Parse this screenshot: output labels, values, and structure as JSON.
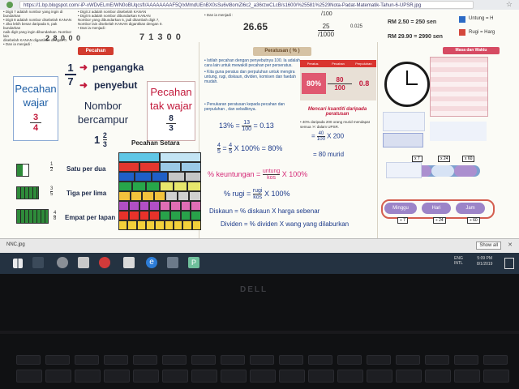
{
  "browser": {
    "url": "https://1.bp.blogspot.com/-iP-xWDvELmE/WN0oBUqcsfI/AAAAAAAAF5Q/xMmdUEnBX0sSu6vl8omZl6c2_a36rzwCLcB/s1600/%25581%2529Nota-Padat-Matematik-Tahun-6-UPSR.jpg"
  },
  "top": {
    "left_lines": [
      "• Digit 7 adalah nombor yang ingin di bundarkan",
      "• Digit 8 adalah nombor disebelah KANAN",
      "• Jika lebih besar daripada 5, pak bundarkan",
      "  naik digit yang ingin dibundarkan. Nombor lain",
      "  disebelah KANAN digantikan dengan 0.",
      "• Dan ia menjadi :"
    ],
    "left_value": "2 8 0 0 0",
    "mid_lines": [
      "• Digit 2 adalah nombor disebelah KANAN",
      "• Digit 5 adalah nombor dibundarkan KANAN",
      "Nombor yang dibundarkan 5, jadi ditambah digit 7,",
      "Nombor lain disebelah KANAN digantikan dengan 0.",
      "• Dan ia menjadi :"
    ],
    "mid_value": "7 1 3 0 0",
    "round_lines": [
      "• Dan ia menjadi :"
    ],
    "round_value": "26.65",
    "frac_top": "/100",
    "frac_mid_num": "25",
    "frac_mid_den": "/1000",
    "frac_dec": "0.025",
    "money1": "RM 2.50 = 250 sen",
    "money2": "RM 29.90 = 2990 sen",
    "legend1": "Untung = H",
    "legend2": "Rugi = Harg"
  },
  "pecahan": {
    "header": "Pecahan",
    "numerator": "1",
    "denominator": "7",
    "pengangka": "pengangka",
    "penyebut": "penyebut",
    "wajar_label": "Pecahan wajar",
    "wajar_num": "3",
    "wajar_den": "4",
    "campur_label": "Nombor bercampur",
    "campur_whole": "1",
    "campur_num": "2",
    "campur_den": "3",
    "takwajar_label": "Pecahan tak wajar",
    "takwajar_num": "8",
    "takwajar_den": "3",
    "setara_title": "Pecahan Setara",
    "rows": [
      {
        "num": "1",
        "den": "2",
        "label": "Satu per dua"
      },
      {
        "num": "3",
        "den": "5",
        "label": "Tiga per lima"
      },
      {
        "num": "4",
        "den": "8",
        "label": "Empat per lapan"
      }
    ]
  },
  "peratusan": {
    "header": "Peratusan ( % )",
    "bullets": [
      "• Istilah pecahan dengan penyebutnya 100. Ia adalah cara lain untuk mewakili pecahan per perseratus.",
      "• Kita guna peratus dan perpuluhan untuk mengira untung, rugi, diskaun, dividen, komisen dan faedah mudah."
    ],
    "table_head": [
      "Peratus",
      "Pecahan",
      "Perpuluhan"
    ],
    "table_vals": [
      "80%",
      "80",
      "100",
      "0.8"
    ],
    "note": "• Penukaran peratusan kepada pecahan dan perpuluhan , dan sebaliknya.",
    "eq1_lhs": "13% =",
    "eq1_num": "13",
    "eq1_den": "100",
    "eq1_rhs": "= 0.13",
    "eq2_num": "4",
    "eq2_den": "5",
    "eq2_rhs": "X 100% = 80%",
    "mencari_title": "Mencari kuantiti daripada peratusan",
    "mencari_text": "• 40% daripada 200 orang murid mendapat semua 'A' dalam UPSR.",
    "mencari_eq_num": "40",
    "mencari_eq_den": "100",
    "mencari_eq_rhs": "X 200",
    "mencari_result": "= 80 murid",
    "keuntungan_label": "% keuntungan =",
    "keuntungan_num": "untung",
    "keuntungan_den": "kos",
    "keuntungan_rhs": "X 100%",
    "rugi_label": "% rugi =",
    "rugi_num": "rugi",
    "rugi_den": "kos",
    "rugi_rhs": "X 100%",
    "diskaun": "Diskaun = % diskaun  X harga sebenar",
    "dividen": "Dividen = % dividen  X wang yang dilaburkan"
  },
  "masa": {
    "header": "Masa dan Waktu",
    "cycle_labels": [
      "Minggu",
      "Hari",
      "Jam"
    ],
    "mult": [
      "x 7",
      "x 24",
      "x 60"
    ],
    "div": [
      "÷ 7",
      "÷ 24",
      "÷ 60"
    ]
  },
  "statusbar": {
    "file": "NNC.jpg",
    "show_all": "Show all"
  },
  "taskbar": {
    "lang": "ENG",
    "region": "INTL",
    "time": "5:09 PM",
    "date": "8/1/2019"
  },
  "laptop": {
    "brand": "DELL"
  },
  "colors": {
    "accent_pink": "#d52b78",
    "header_red": "#c0392b",
    "taskbar": "#243241"
  }
}
